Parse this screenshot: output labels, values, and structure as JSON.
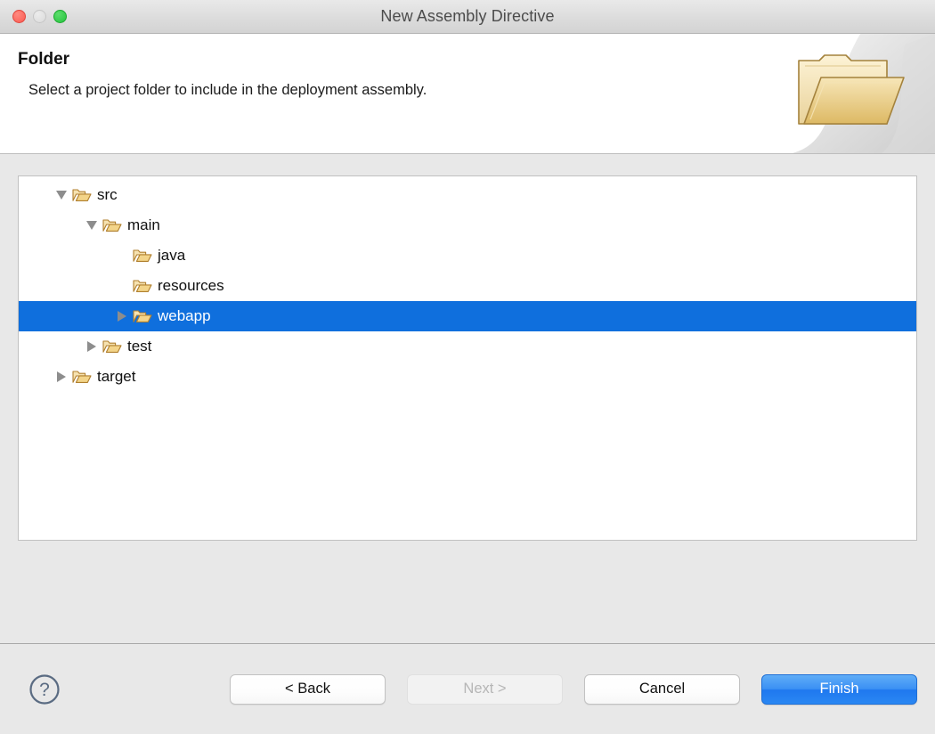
{
  "window": {
    "title": "New Assembly Directive",
    "traffic_lights": [
      {
        "name": "close",
        "color": "#fa5b52"
      },
      {
        "name": "minimize",
        "color": "#dadada"
      },
      {
        "name": "zoom",
        "color": "#25c33e"
      }
    ]
  },
  "header": {
    "title": "Folder",
    "description": "Select a project folder to include in the deployment assembly.",
    "artwork_icon": "open-folder-illustration"
  },
  "tree": {
    "selected_item": "webapp",
    "selection_color": "#0f6fdd",
    "nodes": [
      {
        "label": "src",
        "depth": 0,
        "twisty": "expanded",
        "icon": "folder-open-icon"
      },
      {
        "label": "main",
        "depth": 1,
        "twisty": "expanded",
        "icon": "folder-open-icon"
      },
      {
        "label": "java",
        "depth": 2,
        "twisty": "none",
        "icon": "folder-open-icon"
      },
      {
        "label": "resources",
        "depth": 2,
        "twisty": "none",
        "icon": "folder-open-icon"
      },
      {
        "label": "webapp",
        "depth": 2,
        "twisty": "collapsed",
        "icon": "folder-open-icon",
        "selected": true
      },
      {
        "label": "test",
        "depth": 1,
        "twisty": "collapsed",
        "icon": "folder-open-icon"
      },
      {
        "label": "target",
        "depth": 0,
        "twisty": "collapsed",
        "icon": "folder-open-icon"
      }
    ]
  },
  "footer": {
    "help_icon": "question-mark-icon",
    "buttons": {
      "back": {
        "label": "< Back",
        "state": "enabled"
      },
      "next": {
        "label": "Next >",
        "state": "disabled"
      },
      "cancel": {
        "label": "Cancel",
        "state": "enabled"
      },
      "finish": {
        "label": "Finish",
        "state": "enabled",
        "color": "#2a87f3"
      }
    }
  }
}
